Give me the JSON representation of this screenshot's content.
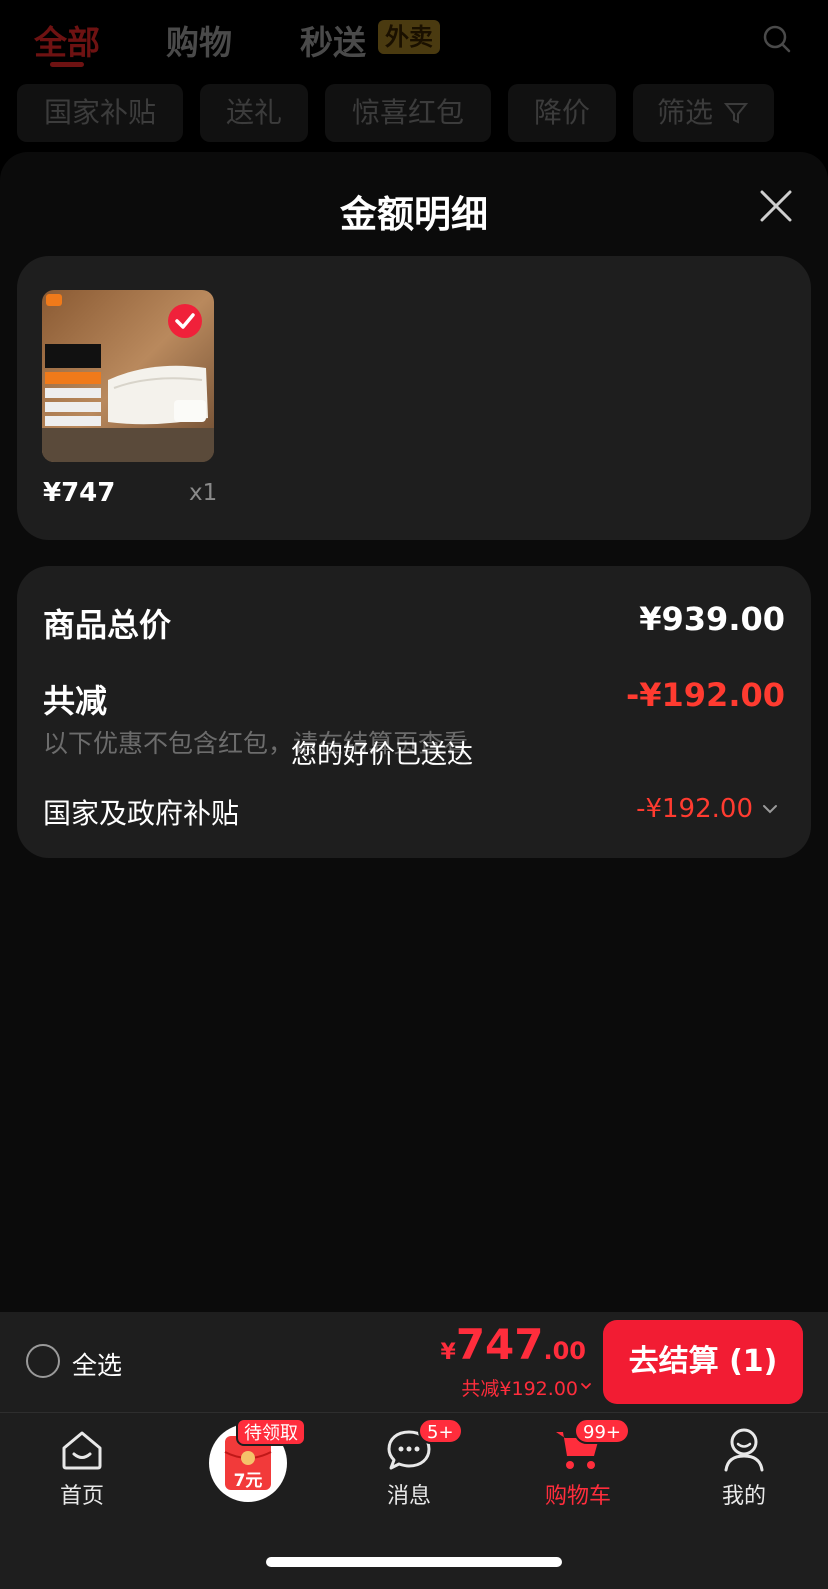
{
  "top_tabs": [
    {
      "label": "全部",
      "active": true
    },
    {
      "label": "购物",
      "active": false
    },
    {
      "label": "秒送",
      "active": false
    }
  ],
  "waimai_badge": "外卖",
  "filters": [
    "国家补贴",
    "送礼",
    "惊喜红包",
    "降价",
    "筛选"
  ],
  "sheet": {
    "title": "金额明细",
    "product": {
      "price": "¥747",
      "quantity": "x1",
      "image_brand": "mi",
      "image_lines": [
        "米家智能",
        "温控水暖毯",
        "智能循环水暖",
        "恒温加热更稳定",
        "<22dB安静运行",
        "AB双区独立控温"
      ],
      "selected": true
    },
    "summary": {
      "total_label": "商品总价",
      "total_value": "¥939.00",
      "reduction_label": "共减",
      "reduction_value": "-¥192.00",
      "note": "以下优惠不包含红包，请在结算页查看",
      "subsidy_label": "国家及政府补贴",
      "subsidy_value": "-¥192.00"
    },
    "toast": "您的好价已送达"
  },
  "action_bar": {
    "select_all": "全选",
    "currency": "¥",
    "total_int": "747",
    "total_dec": ".00",
    "discount": "共减¥192.00",
    "checkout": "去结算 (1)"
  },
  "tabbar": {
    "items": [
      {
        "label": "首页",
        "icon": "home-icon"
      },
      {
        "label": "",
        "icon": "red-envelope-icon"
      },
      {
        "label": "消息",
        "icon": "message-icon",
        "badge": "5+"
      },
      {
        "label": "购物车",
        "icon": "cart-icon",
        "badge": "99+",
        "active": true
      },
      {
        "label": "我的",
        "icon": "profile-icon"
      }
    ],
    "promo_badge": "待领取",
    "promo_text": "7元"
  },
  "colors": {
    "accent": "#ff2d3c",
    "checkout": "#f21c33",
    "card": "#1e1e1e"
  }
}
